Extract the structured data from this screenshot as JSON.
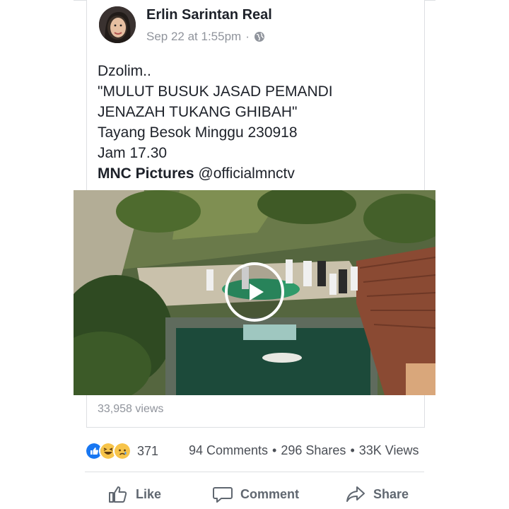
{
  "post": {
    "author": "Erlin Sarintan Real",
    "time": "Sep 22 at 1:55pm",
    "separator": "·",
    "lines": [
      "Dzolim..",
      "\"MULUT BUSUK  JASAD PEMANDI",
      "JENAZAH TUKANG GHIBAH\"",
      "Tayang Besok Minggu 230918",
      "Jam 17.30"
    ],
    "mention_bold": "MNC Pictures",
    "mention_handle": "@officialmnctv"
  },
  "video": {
    "views": "33,958 views"
  },
  "engagement": {
    "reaction_count": "371",
    "comments": "94 Comments",
    "shares": "296 Shares",
    "views": "33K Views",
    "dot": "•"
  },
  "actions": {
    "like": "Like",
    "comment": "Comment",
    "share": "Share"
  },
  "colors": {
    "like_blue": "#1877f2",
    "reaction_yellow": "#f7c44a",
    "text_gray": "#606770",
    "meta_gray": "#90949c"
  },
  "icons": [
    "globe-icon",
    "play-icon",
    "like-reaction-icon",
    "haha-reaction-icon",
    "sad-reaction-icon",
    "thumbs-up-icon",
    "comment-icon",
    "share-icon"
  ]
}
